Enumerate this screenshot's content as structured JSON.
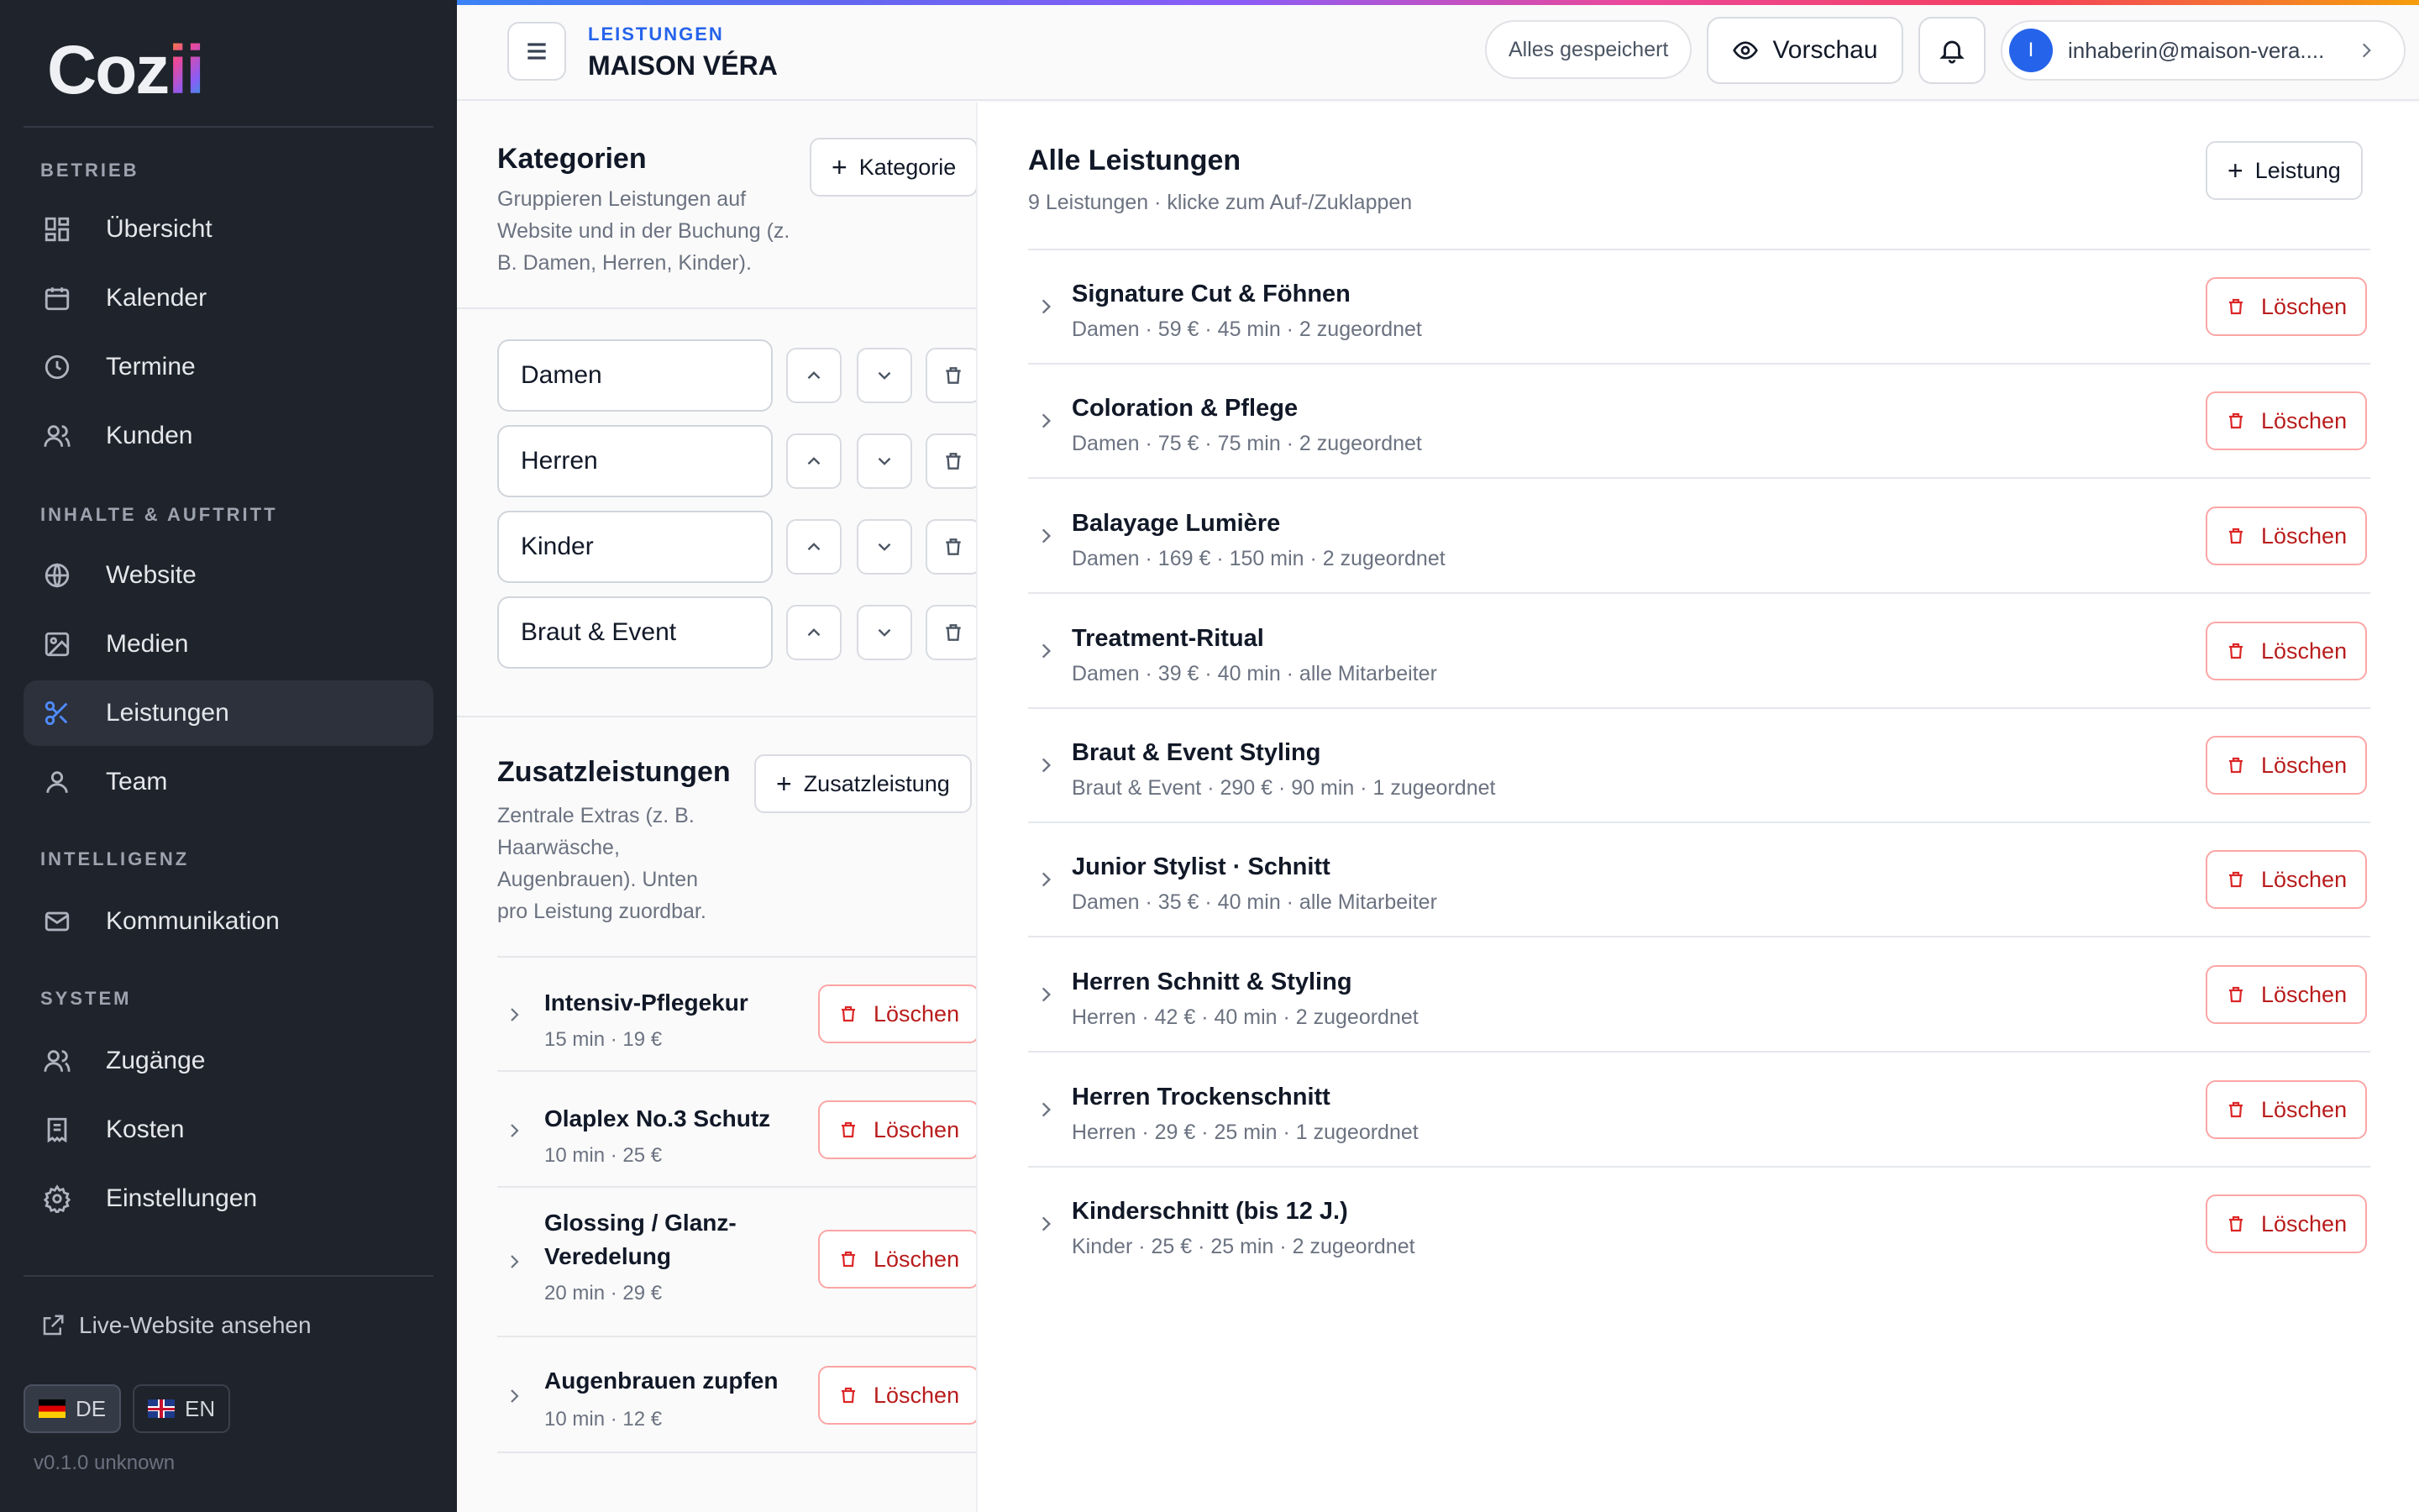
{
  "app": {
    "logo_text_main": "Coz",
    "logo_text_accent": "ii"
  },
  "sidebar": {
    "sections": [
      {
        "label": "BETRIEB"
      },
      {
        "label": "INHALTE & AUFTRITT"
      },
      {
        "label": "INTELLIGENZ"
      },
      {
        "label": "SYSTEM"
      }
    ],
    "items": [
      {
        "label": "Übersicht"
      },
      {
        "label": "Kalender"
      },
      {
        "label": "Termine"
      },
      {
        "label": "Kunden"
      },
      {
        "label": "Website"
      },
      {
        "label": "Medien"
      },
      {
        "label": "Leistungen"
      },
      {
        "label": "Team"
      },
      {
        "label": "Kommunikation"
      },
      {
        "label": "Zugänge"
      },
      {
        "label": "Kosten"
      },
      {
        "label": "Einstellungen"
      }
    ],
    "live_link": "Live-Website ansehen",
    "languages": [
      {
        "code": "DE"
      },
      {
        "code": "EN"
      }
    ],
    "version": "v0.1.0 unknown"
  },
  "header": {
    "breadcrumb_label": "LEISTUNGEN",
    "title": "MAISON VÉRA",
    "saved_status": "Alles gespeichert",
    "preview_label": "Vorschau",
    "avatar_initial": "I",
    "account_email": "inhaberin@maison-vera...."
  },
  "categories": {
    "title": "Kategorien",
    "add_label": "Kategorie",
    "description": "Gruppieren Leistungen auf Website und in der Buchung (z. B. Damen, Herren, Kinder).",
    "items": [
      {
        "value": "Damen"
      },
      {
        "value": "Herren"
      },
      {
        "value": "Kinder"
      },
      {
        "value": "Braut & Event"
      }
    ]
  },
  "extras": {
    "title": "Zusatzleistungen",
    "add_label": "Zusatzleistung",
    "description": "Zentrale Extras (z. B. Haarwäsche, Augenbrauen). Unten pro Leistung zuordbar.",
    "delete_label": "Löschen",
    "items": [
      {
        "name": "Intensiv-Pflegekur",
        "meta": "15 min · 19 €"
      },
      {
        "name": "Olaplex No.3 Schutz",
        "meta": "10 min · 25 €"
      },
      {
        "name": "Glossing / Glanz-Veredelung",
        "meta": "20 min · 29 €"
      },
      {
        "name": "Augenbrauen zupfen",
        "meta": "10 min · 12 €"
      }
    ]
  },
  "services": {
    "title": "Alle Leistungen",
    "subtitle": "9 Leistungen · klicke zum Auf-/Zuklappen",
    "add_label": "Leistung",
    "delete_label": "Löschen",
    "items": [
      {
        "name": "Signature Cut & Föhnen",
        "meta": "Damen · 59 € · 45 min · 2 zugeordnet"
      },
      {
        "name": "Coloration & Pflege",
        "meta": "Damen · 75 € · 75 min · 2 zugeordnet"
      },
      {
        "name": "Balayage Lumière",
        "meta": "Damen · 169 € · 150 min · 2 zugeordnet"
      },
      {
        "name": "Treatment-Ritual",
        "meta": "Damen · 39 € · 40 min · alle Mitarbeiter"
      },
      {
        "name": "Braut & Event Styling",
        "meta": "Braut & Event · 290 € · 90 min · 1 zugeordnet"
      },
      {
        "name": "Junior Stylist · Schnitt",
        "meta": "Damen · 35 € · 40 min · alle Mitarbeiter"
      },
      {
        "name": "Herren Schnitt & Styling",
        "meta": "Herren · 42 € · 40 min · 2 zugeordnet"
      },
      {
        "name": "Herren Trockenschnitt",
        "meta": "Herren · 29 € · 25 min · 1 zugeordnet"
      },
      {
        "name": "Kinderschnitt (bis 12 J.)",
        "meta": "Kinder · 25 € · 25 min · 2 zugeordnet"
      }
    ]
  },
  "colors": {
    "accent": "#2563eb",
    "danger": "#b91c1c",
    "sidebar_bg": "#1f232b"
  }
}
